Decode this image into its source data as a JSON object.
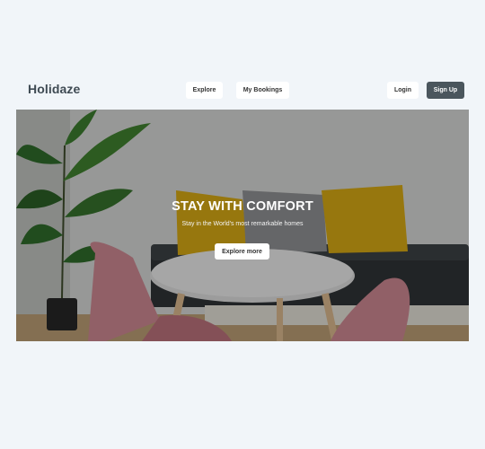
{
  "header": {
    "brand": "Holidaze",
    "nav": {
      "explore": "Explore",
      "my_bookings": "My Bookings"
    },
    "auth": {
      "login": "Login",
      "signup": "Sign Up"
    }
  },
  "hero": {
    "title": "STAY WITH COMFORT",
    "subtitle": "Stay in the World's most remarkable homes",
    "cta": "Explore more"
  },
  "colors": {
    "page_background": "#f1f5f9",
    "brand_text": "#3f4a53",
    "signup_button": "#4b565d",
    "button_background": "#ffffff"
  }
}
